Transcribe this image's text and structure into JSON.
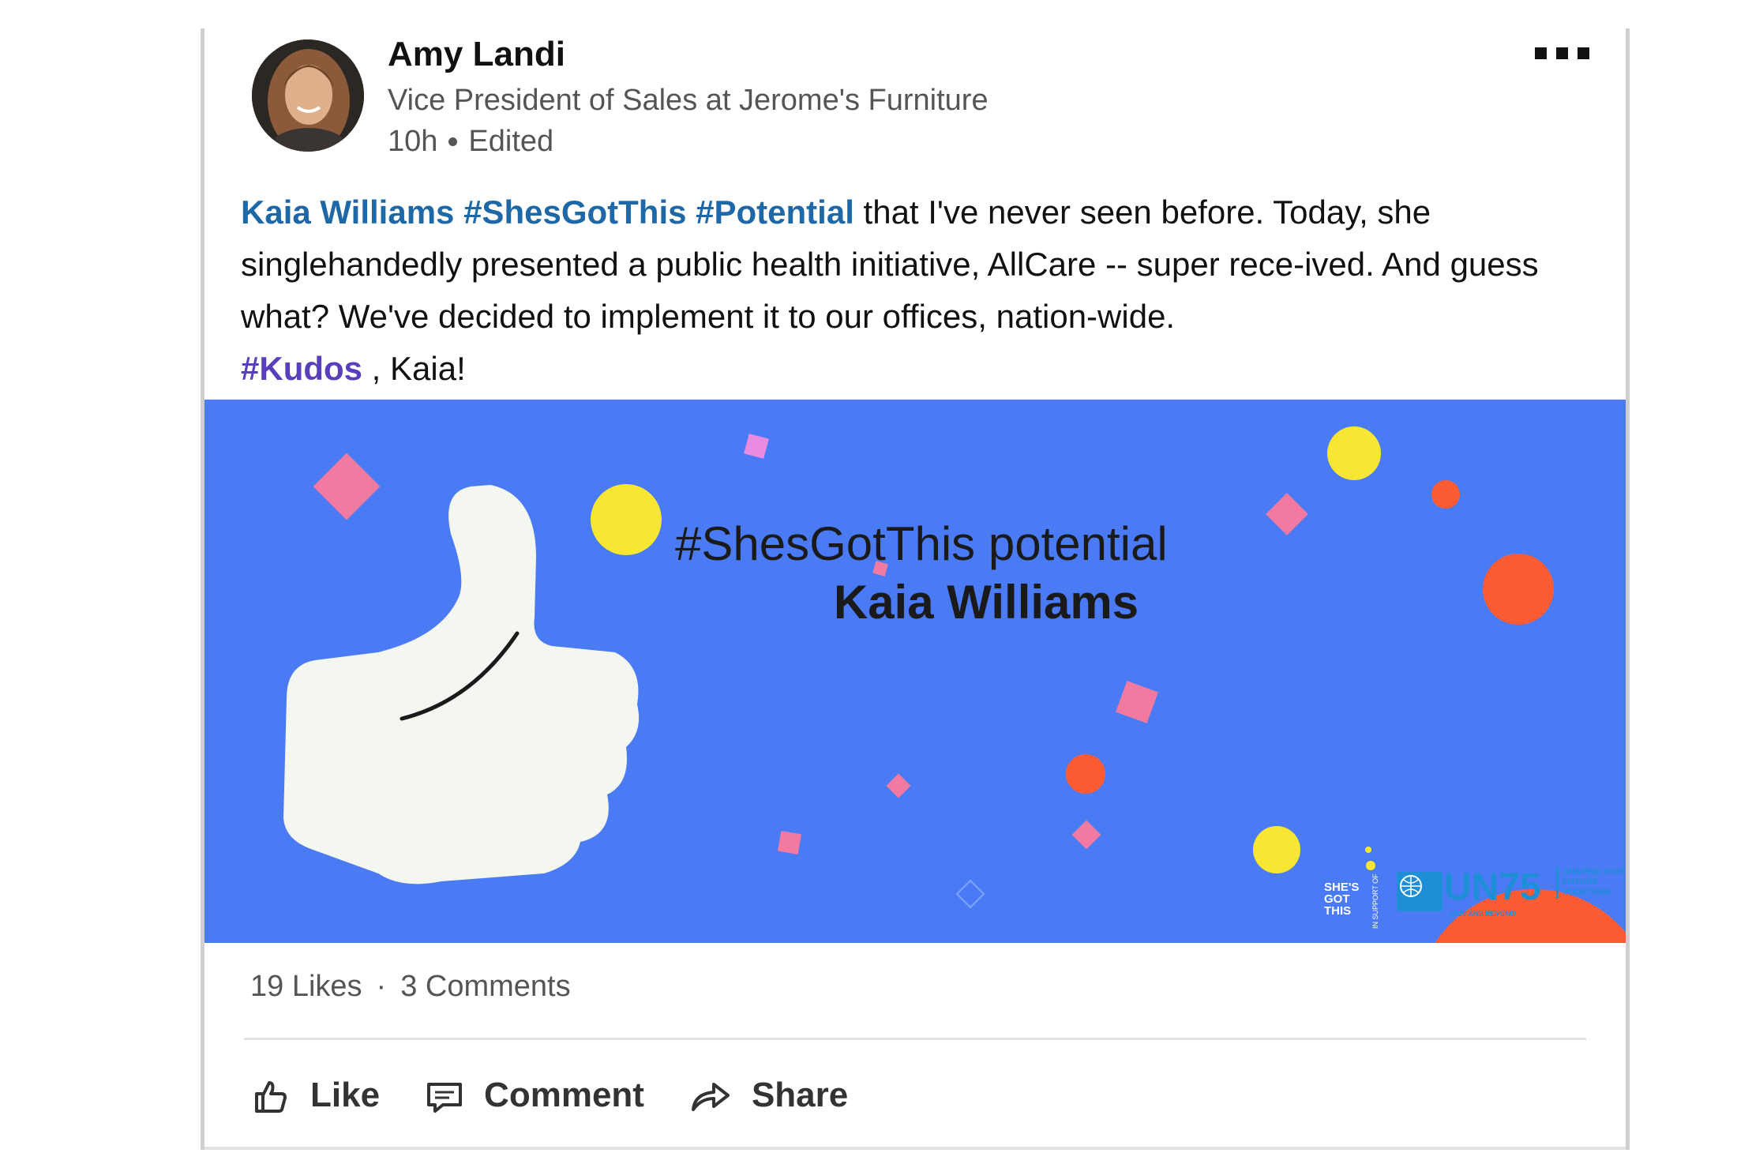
{
  "post": {
    "author": {
      "name": "Amy Landi",
      "title": "Vice President of Sales at Jerome's Furniture",
      "time": "10h",
      "status": "Edited"
    },
    "body": {
      "mention": "Kaia Williams",
      "tag1": "#ShesGotThis",
      "tag2": "#Potential",
      "text1": " that I've never seen before. Today, she singlehandedly presented a public health initiative, AllCare -- super rece-ived. And guess what? We've decided to implement it to our offices, nation-wide.",
      "tag3": "#Kudos",
      "text2": " , Kaia!"
    },
    "banner": {
      "title": "#ShesGotThis potential",
      "name": "Kaia Williams",
      "logos": {
        "shes_got_this": "SHE'S GOT THIS",
        "in_support_of": "IN SUPPORT OF",
        "un75": "UN75",
        "un75_sub": "2020 AND BEYOND",
        "shaping": "SHAPING OUR FUTURE TOGETHER"
      }
    },
    "stats": {
      "likes": "19 Likes",
      "separator": "·",
      "comments": "3 Comments"
    },
    "actions": {
      "like": "Like",
      "comment": "Comment",
      "share": "Share"
    }
  },
  "colors": {
    "link_blue": "#1e68a8",
    "hashtag_purple": "#5a3fbc",
    "banner_blue": "#4b7af5",
    "accent_yellow": "#f7e733",
    "accent_orange": "#fd5b34",
    "accent_pink": "#f27aa0"
  },
  "icons": [
    "more-icon",
    "thumbs-up-icon",
    "comment-icon",
    "share-icon"
  ]
}
